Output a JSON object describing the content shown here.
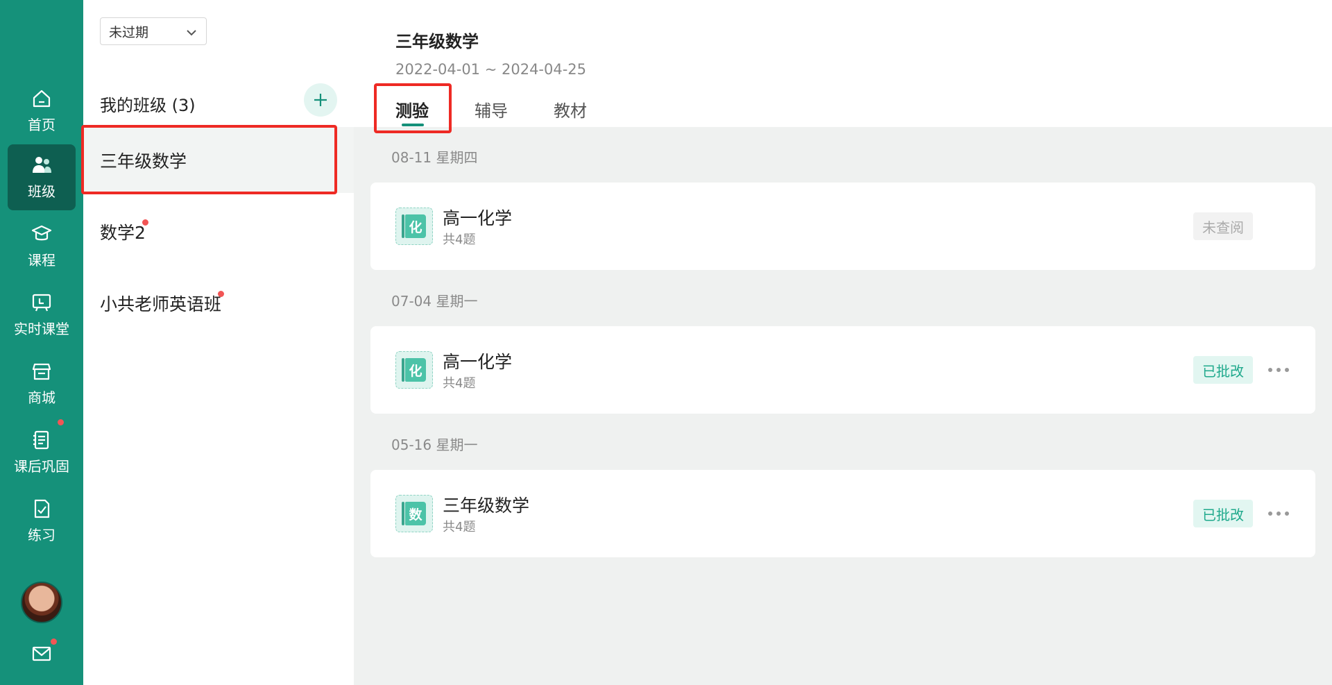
{
  "nav": {
    "items": [
      {
        "label": "首页",
        "icon": "home-icon"
      },
      {
        "label": "班级",
        "icon": "class-icon"
      },
      {
        "label": "课程",
        "icon": "course-icon"
      },
      {
        "label": "实时课堂",
        "icon": "live-class-icon"
      },
      {
        "label": "商城",
        "icon": "store-icon"
      },
      {
        "label": "课后巩固",
        "icon": "homework-icon"
      },
      {
        "label": "练习",
        "icon": "practice-icon"
      }
    ],
    "active": "班级"
  },
  "classes": {
    "filter_value": "未过期",
    "header": "我的班级 (3)",
    "items": [
      {
        "name": "三年级数学"
      },
      {
        "name": "数学2"
      },
      {
        "name": "小共老师英语班"
      }
    ]
  },
  "course": {
    "title": "三年级数学",
    "dates": "2022-04-01 ~ 2024-04-25",
    "tabs": [
      "测验",
      "辅导",
      "教材"
    ]
  },
  "quiz_groups": [
    {
      "date": "08-11 星期四",
      "title": "高一化学",
      "subject_char": "化",
      "count": "共4题",
      "status": "未查阅"
    },
    {
      "date": "07-04 星期一",
      "title": "高一化学",
      "subject_char": "化",
      "count": "共4题",
      "status": "已批改"
    },
    {
      "date": "05-16 星期一",
      "title": "三年级数学",
      "subject_char": "数",
      "count": "共4题",
      "status": "已批改"
    }
  ],
  "colors": {
    "brand": "#15917a",
    "brand_dark": "#0e5f51",
    "highlight": "#ee2a24",
    "badge": "#f25555"
  }
}
